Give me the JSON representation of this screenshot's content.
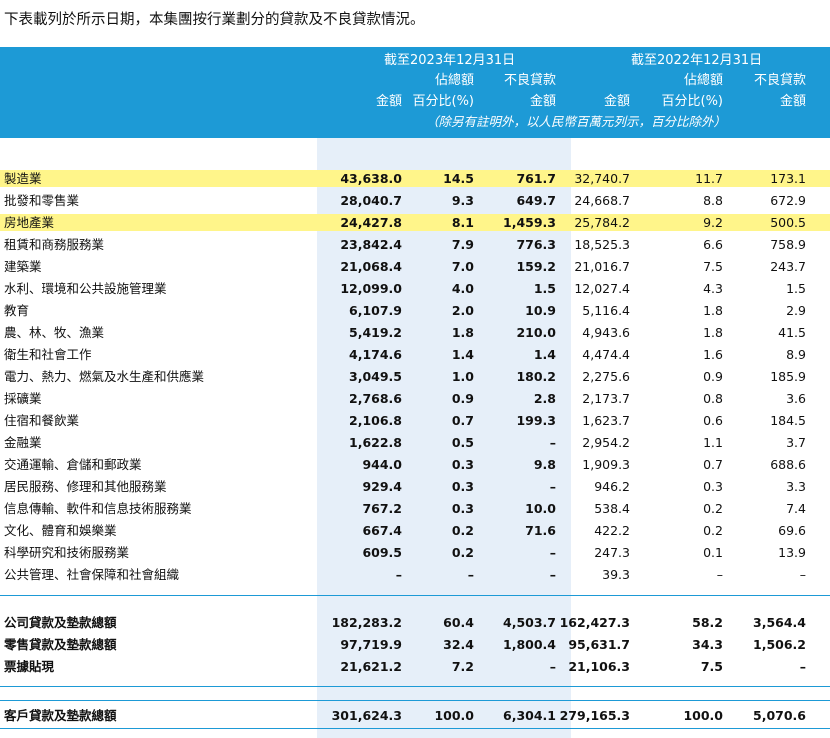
{
  "intro": "下表載列於所示日期，本集團按行業劃分的貸款及不良貸款情況。",
  "header": {
    "period_2023": "截至2023年12月31日",
    "period_2022": "截至2022年12月31日",
    "pct_of_total_line1": "佔總額",
    "npl_line1": "不良貸款",
    "amount": "金額",
    "pct_of_total_line2": "百分比(%)",
    "npl_line2": "金額",
    "note": "（除另有註明外，以人民幣百萬元列示，百分比除外）"
  },
  "industry_rows": [
    {
      "name": "製造業",
      "v": [
        "43,638.0",
        "14.5",
        "761.7",
        "32,740.7",
        "11.7",
        "173.1"
      ]
    },
    {
      "name": "批發和零售業",
      "v": [
        "28,040.7",
        "9.3",
        "649.7",
        "24,668.7",
        "8.8",
        "672.9"
      ]
    },
    {
      "name": "房地產業",
      "v": [
        "24,427.8",
        "8.1",
        "1,459.3",
        "25,784.2",
        "9.2",
        "500.5"
      ]
    },
    {
      "name": "租賃和商務服務業",
      "v": [
        "23,842.4",
        "7.9",
        "776.3",
        "18,525.3",
        "6.6",
        "758.9"
      ]
    },
    {
      "name": "建築業",
      "v": [
        "21,068.4",
        "7.0",
        "159.2",
        "21,016.7",
        "7.5",
        "243.7"
      ]
    },
    {
      "name": "水利、環境和公共設施管理業",
      "v": [
        "12,099.0",
        "4.0",
        "1.5",
        "12,027.4",
        "4.3",
        "1.5"
      ]
    },
    {
      "name": "教育",
      "v": [
        "6,107.9",
        "2.0",
        "10.9",
        "5,116.4",
        "1.8",
        "2.9"
      ]
    },
    {
      "name": "農、林、牧、漁業",
      "v": [
        "5,419.2",
        "1.8",
        "210.0",
        "4,943.6",
        "1.8",
        "41.5"
      ]
    },
    {
      "name": "衛生和社會工作",
      "v": [
        "4,174.6",
        "1.4",
        "1.4",
        "4,474.4",
        "1.6",
        "8.9"
      ]
    },
    {
      "name": "電力、熱力、燃氣及水生產和供應業",
      "v": [
        "3,049.5",
        "1.0",
        "180.2",
        "2,275.6",
        "0.9",
        "185.9"
      ]
    },
    {
      "name": "採礦業",
      "v": [
        "2,768.6",
        "0.9",
        "2.8",
        "2,173.7",
        "0.8",
        "3.6"
      ]
    },
    {
      "name": "住宿和餐飲業",
      "v": [
        "2,106.8",
        "0.7",
        "199.3",
        "1,623.7",
        "0.6",
        "184.5"
      ]
    },
    {
      "name": "金融業",
      "v": [
        "1,622.8",
        "0.5",
        "–",
        "2,954.2",
        "1.1",
        "3.7"
      ]
    },
    {
      "name": "交通運輸、倉儲和郵政業",
      "v": [
        "944.0",
        "0.3",
        "9.8",
        "1,909.3",
        "0.7",
        "688.6"
      ]
    },
    {
      "name": "居民服務、修理和其他服務業",
      "v": [
        "929.4",
        "0.3",
        "–",
        "946.2",
        "0.3",
        "3.3"
      ]
    },
    {
      "name": "信息傳輸、軟件和信息技術服務業",
      "v": [
        "767.2",
        "0.3",
        "10.0",
        "538.4",
        "0.2",
        "7.4"
      ]
    },
    {
      "name": "文化、體育和娛樂業",
      "v": [
        "667.4",
        "0.2",
        "71.6",
        "422.2",
        "0.2",
        "69.6"
      ]
    },
    {
      "name": "科學研究和技術服務業",
      "v": [
        "609.5",
        "0.2",
        "–",
        "247.3",
        "0.1",
        "13.9"
      ]
    },
    {
      "name": "公共管理、社會保障和社會組織",
      "v": [
        "–",
        "–",
        "–",
        "39.3",
        "–",
        "–"
      ]
    }
  ],
  "subtotal_rows": [
    {
      "name": "公司貸款及墊款總額",
      "v": [
        "182,283.2",
        "60.4",
        "4,503.7",
        "162,427.3",
        "58.2",
        "3,564.4"
      ]
    },
    {
      "name": "零售貸款及墊款總額",
      "v": [
        "97,719.9",
        "32.4",
        "1,800.4",
        "95,631.7",
        "34.3",
        "1,506.2"
      ]
    },
    {
      "name": "票據貼現",
      "v": [
        "21,621.2",
        "7.2",
        "–",
        "21,106.3",
        "7.5",
        "–"
      ]
    }
  ],
  "total_row": {
    "name": "客戶貸款及墊款總額",
    "v": [
      "301,624.3",
      "100.0",
      "6,304.1",
      "279,165.3",
      "100.0",
      "5,070.6"
    ]
  }
}
